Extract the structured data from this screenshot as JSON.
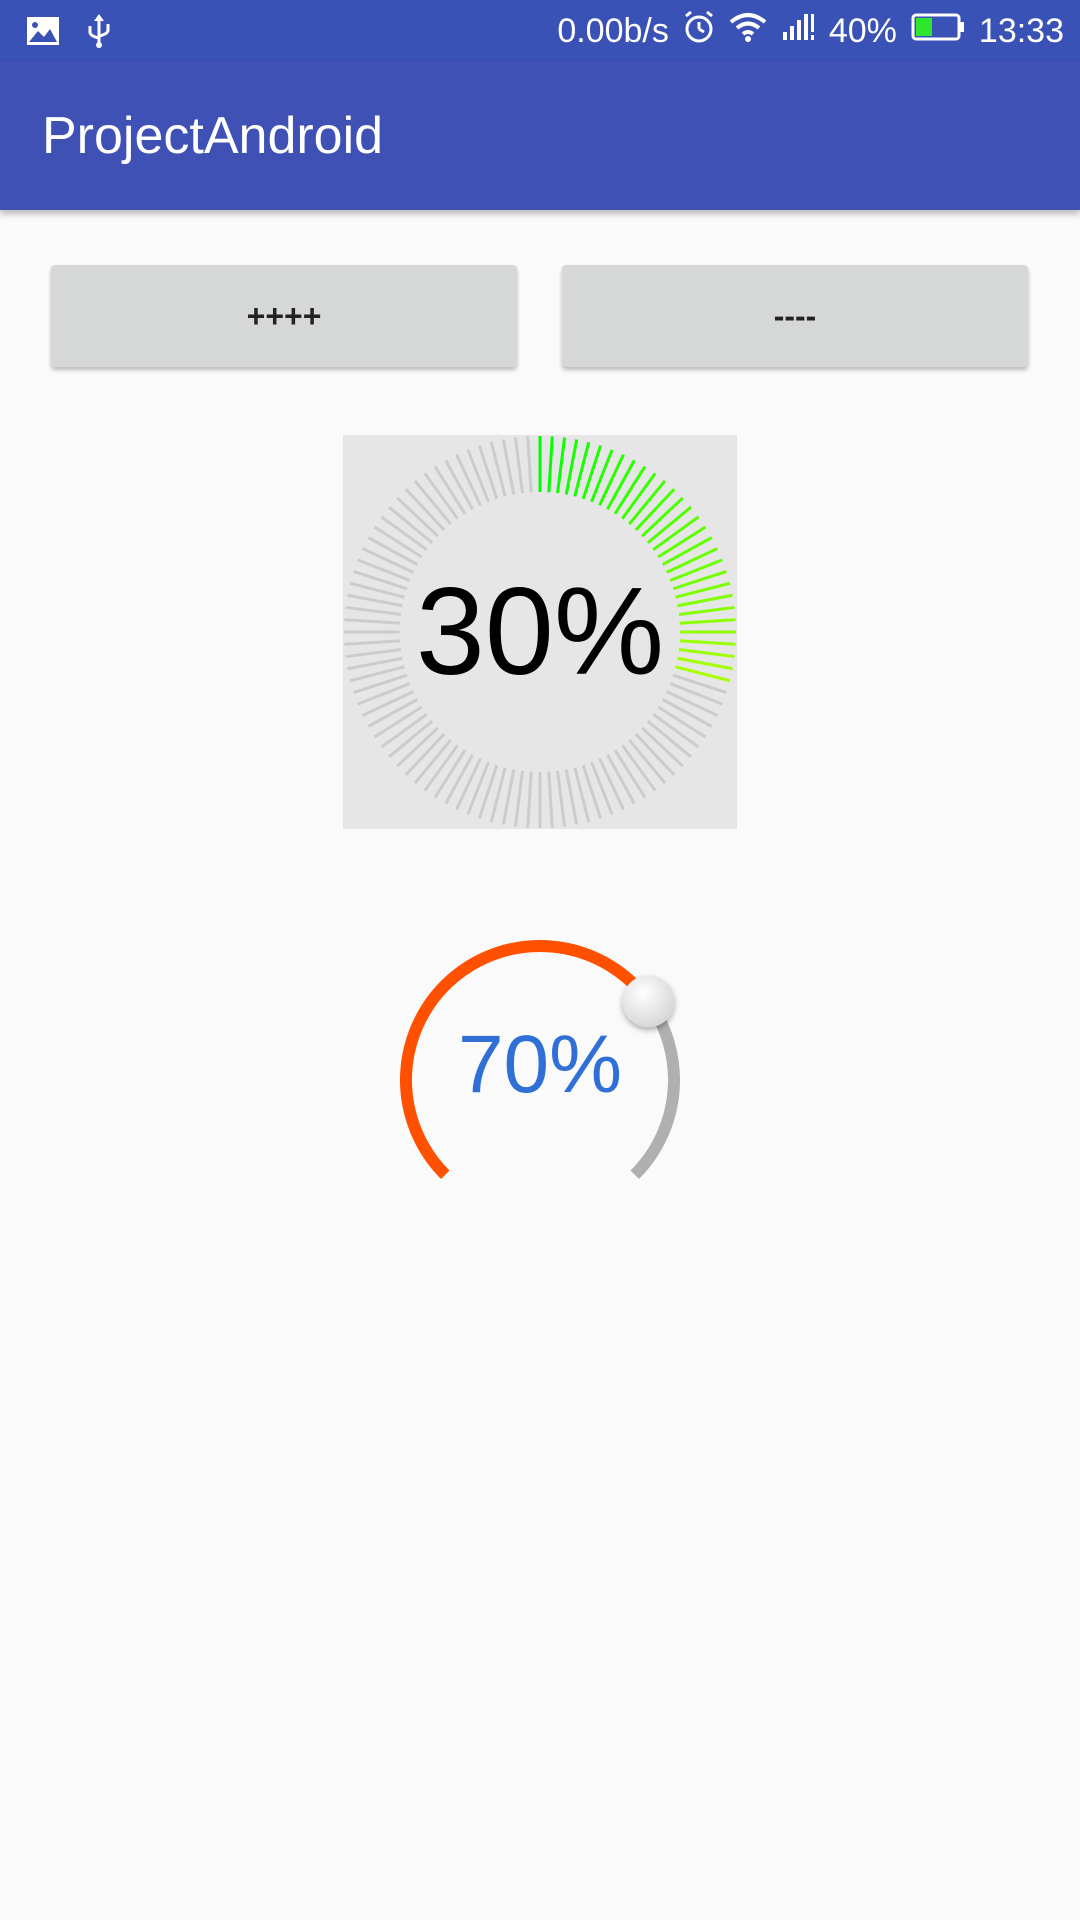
{
  "status_bar": {
    "network_speed": "0.00b/s",
    "battery_percent": "40%",
    "battery_level": 0.4,
    "time": "13:33",
    "icons": [
      "image-icon",
      "usb-icon",
      "alarm-icon",
      "wifi-icon",
      "signal-icon",
      "battery-icon"
    ]
  },
  "app_bar": {
    "title": "ProjectAndroid",
    "color": "#3f51b5"
  },
  "buttons": {
    "increase_label": "++++",
    "decrease_label": "----"
  },
  "tick_dial": {
    "label": "30%",
    "value": 0.3,
    "active_color_start": "#00ff00",
    "active_color_end": "#a8ff00",
    "inactive_color": "#cccccc"
  },
  "arc_seekbar": {
    "label": "70%",
    "value": 0.7,
    "progress_color": "#ff5000",
    "track_color": "#b0b0b0",
    "label_color": "#2f6fd6"
  }
}
